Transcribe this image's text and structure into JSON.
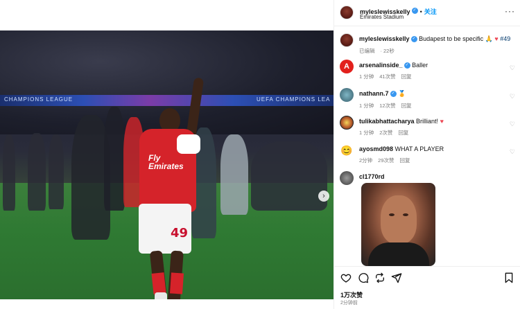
{
  "post": {
    "author": "myleslewisskelly",
    "follow_label": "关注",
    "location": "Emirates Stadium",
    "more_label": "···"
  },
  "photo": {
    "banner_left": "CHAMPIONS LEAGUE",
    "banner_right": "UEFA CHAMPIONS LEA",
    "shirt_text": "Fly\nEmirates",
    "shorts_number": "49",
    "carousel_next": "›",
    "dots": 5,
    "active_dot": 0
  },
  "caption": {
    "username": "myleslewisskelly",
    "text": "Budapest to be specific",
    "emoji_pray": "🙏",
    "emoji_heart": "♥",
    "hashtag": "#49",
    "edited": "已编辑",
    "time": "22秒"
  },
  "comments": [
    {
      "username": "arsenalinside_",
      "verified": true,
      "text": "Baller",
      "time": "1 分钟",
      "likes": "41次赞",
      "reply": "回复"
    },
    {
      "username": "nathann.7",
      "verified": true,
      "text": "🏅",
      "time": "1 分钟",
      "likes": "12次赞",
      "reply": "回复"
    },
    {
      "username": "tulikabhattacharya",
      "verified": false,
      "text": "Brilliant!",
      "emoji": "♥",
      "time": "1 分钟",
      "likes": "2次赞",
      "reply": "回复"
    },
    {
      "username": "ayosmd098",
      "verified": false,
      "text": "WHAT A PLAYER",
      "time": "2分钟",
      "likes": "29次赞",
      "reply": "回复"
    },
    {
      "username": "cl1770rd",
      "verified": false,
      "text": ""
    }
  ],
  "actions": {
    "likes": "1万次赞",
    "time": "2分钟前"
  },
  "colors": {
    "accent": "#0095f6",
    "verified": "#3897f0",
    "heart": "#ed4956",
    "arsenal_red": "#d5232a"
  }
}
